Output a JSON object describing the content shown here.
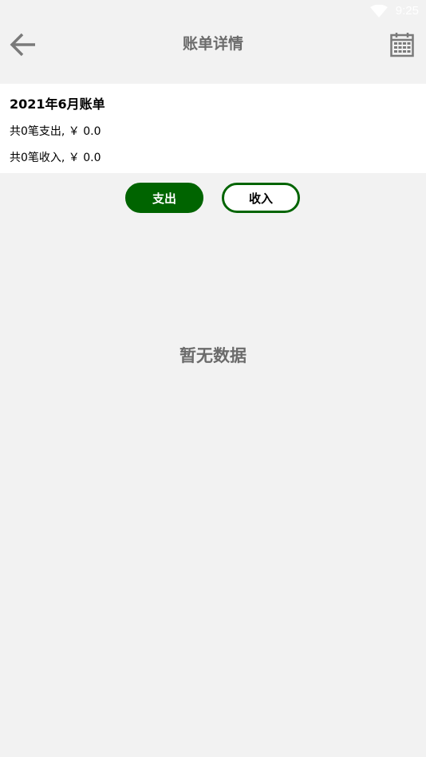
{
  "status_bar": {
    "time": "9:25"
  },
  "header": {
    "title": "账单详情",
    "back_icon": "arrow-left-icon",
    "calendar_icon": "calendar-icon"
  },
  "summary": {
    "month_title": "2021年6月账单",
    "expense_summary": "共0笔支出, ￥ 0.0",
    "income_summary": "共0笔收入, ￥ 0.0"
  },
  "toggle": {
    "expense_label": "支出",
    "income_label": "收入",
    "selected": "expense"
  },
  "empty_state": {
    "text": "暂无数据"
  },
  "colors": {
    "accent": "#006400",
    "background": "#f2f2f2",
    "title_gray": "#6b6b6b"
  }
}
